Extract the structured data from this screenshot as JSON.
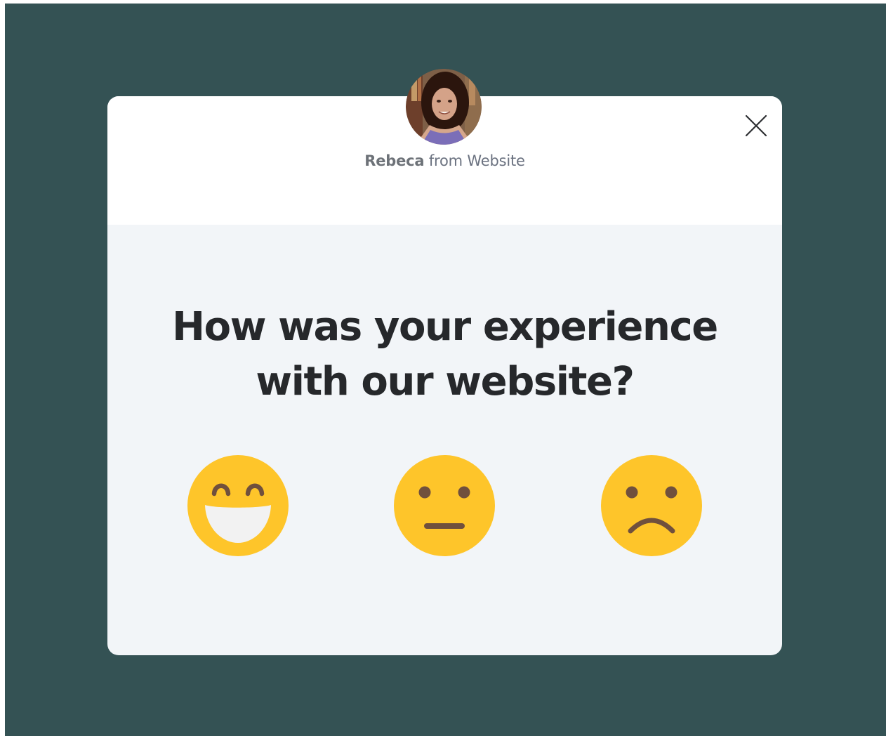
{
  "survey": {
    "sender_name": "Rebeca",
    "sender_suffix": " from Website",
    "question_line1": "How was your experience",
    "question_line2": "with our website?",
    "options": [
      {
        "icon": "grinning-face-icon"
      },
      {
        "icon": "neutral-face-icon"
      },
      {
        "icon": "frowning-face-icon"
      }
    ],
    "close_icon": "close-icon",
    "avatar_icon": "avatar"
  },
  "colors": {
    "backdrop": "#345254",
    "card_body": "#f2f5f8",
    "card_header": "#ffffff",
    "emoji_yellow": "#fec52a",
    "emoji_features": "#70503d",
    "heading_text": "#26282b"
  }
}
